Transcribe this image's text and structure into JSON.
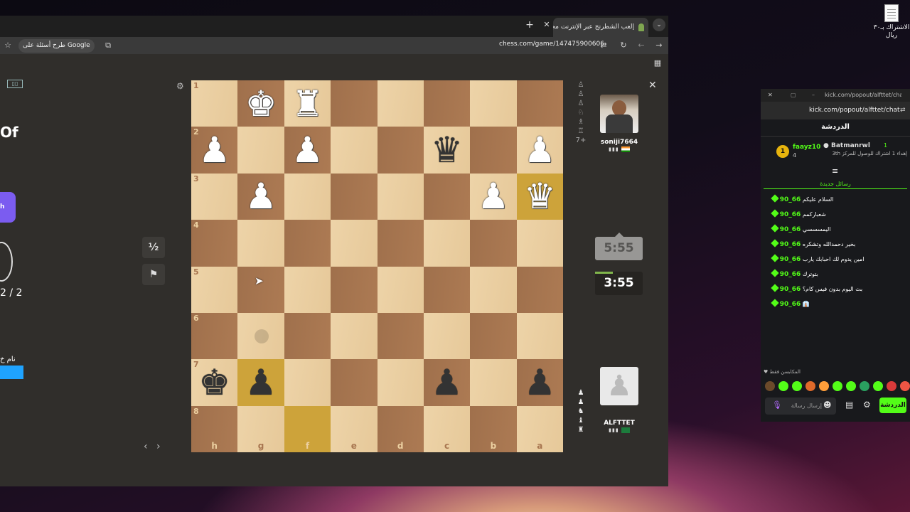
{
  "desktop": {
    "icon_label": "الاشتراك بـ٣٠ ريال"
  },
  "browser": {
    "tab_title": "إلعب الشطرنج عبر الإنترنت مجاناً",
    "url": "chess.com/game/147475900606",
    "google_button": "طرح أسئلة على Google"
  },
  "left_partial": {
    "heading": "Of",
    "purple_btn": "h",
    "caption": "نام خ"
  },
  "board": {
    "side_buttons": {
      "draw": "½",
      "resign": "⚑"
    },
    "ranks": [
      "1",
      "2",
      "3",
      "4",
      "5",
      "6",
      "7",
      "8"
    ],
    "files": [
      "h",
      "g",
      "f",
      "e",
      "d",
      "c",
      "b",
      "a"
    ],
    "pieces": [
      {
        "sq": "g1",
        "p": "♚",
        "c": "w"
      },
      {
        "sq": "f1",
        "p": "♜",
        "c": "w"
      },
      {
        "sq": "h2",
        "p": "♟",
        "c": "w"
      },
      {
        "sq": "f2",
        "p": "♟",
        "c": "w"
      },
      {
        "sq": "c2",
        "p": "♛",
        "c": "b"
      },
      {
        "sq": "a2",
        "p": "♟",
        "c": "w"
      },
      {
        "sq": "g3",
        "p": "♟",
        "c": "w"
      },
      {
        "sq": "b3",
        "p": "♟",
        "c": "w"
      },
      {
        "sq": "a3",
        "p": "♛",
        "c": "w"
      },
      {
        "sq": "h7",
        "p": "♚",
        "c": "b"
      },
      {
        "sq": "g7",
        "p": "♟",
        "c": "b"
      },
      {
        "sq": "c7",
        "p": "♟",
        "c": "b"
      },
      {
        "sq": "a7",
        "p": "♟",
        "c": "b"
      }
    ],
    "highlights": [
      "a3",
      "g7",
      "f8"
    ]
  },
  "players": {
    "top": {
      "name": "soniji7664",
      "clock": "5:55",
      "captures": [
        "♙",
        "♙",
        "♙",
        "♘",
        "♗",
        "♖"
      ],
      "extra": "7+"
    },
    "bottom": {
      "name": "ALFTTET",
      "clock": "3:55",
      "captures": [
        "♟",
        "♟",
        "♞",
        "♝",
        "♜"
      ]
    }
  },
  "chat": {
    "window_title": "kick.com/popout/alfttet/chat",
    "url": "kick.com/popout/alfttet/chat",
    "header": "الدردشة",
    "pinned": {
      "user1": "faayz10",
      "count1": "4",
      "user2": "Batmanrwl",
      "count2": "1",
      "text": "إهداء 1 اشتراك للوصول للمركز 3th"
    },
    "new_messages": "رسائل جديدة",
    "messages": [
      {
        "user": "66_90",
        "text": "السلام عليكم"
      },
      {
        "user": "66_90",
        "text": "شعباركمم"
      },
      {
        "user": "66_90",
        "text": "اليمسسسي"
      },
      {
        "user": "66_90",
        "text": "بخير دحمدالله وتشكره"
      },
      {
        "user": "66_90",
        "text": "امين يدوم لك احبابك يارب"
      },
      {
        "user": "66_90",
        "text": "بتوترك"
      },
      {
        "user": "66_90",
        "text": "بث اليوم بدون فيس كام؟"
      },
      {
        "user": "66_90",
        "text": "👔"
      }
    ],
    "emote_label": "المكابسن فقط",
    "input_placeholder": "إرسال رسالة",
    "send_button": "الدردشة"
  }
}
